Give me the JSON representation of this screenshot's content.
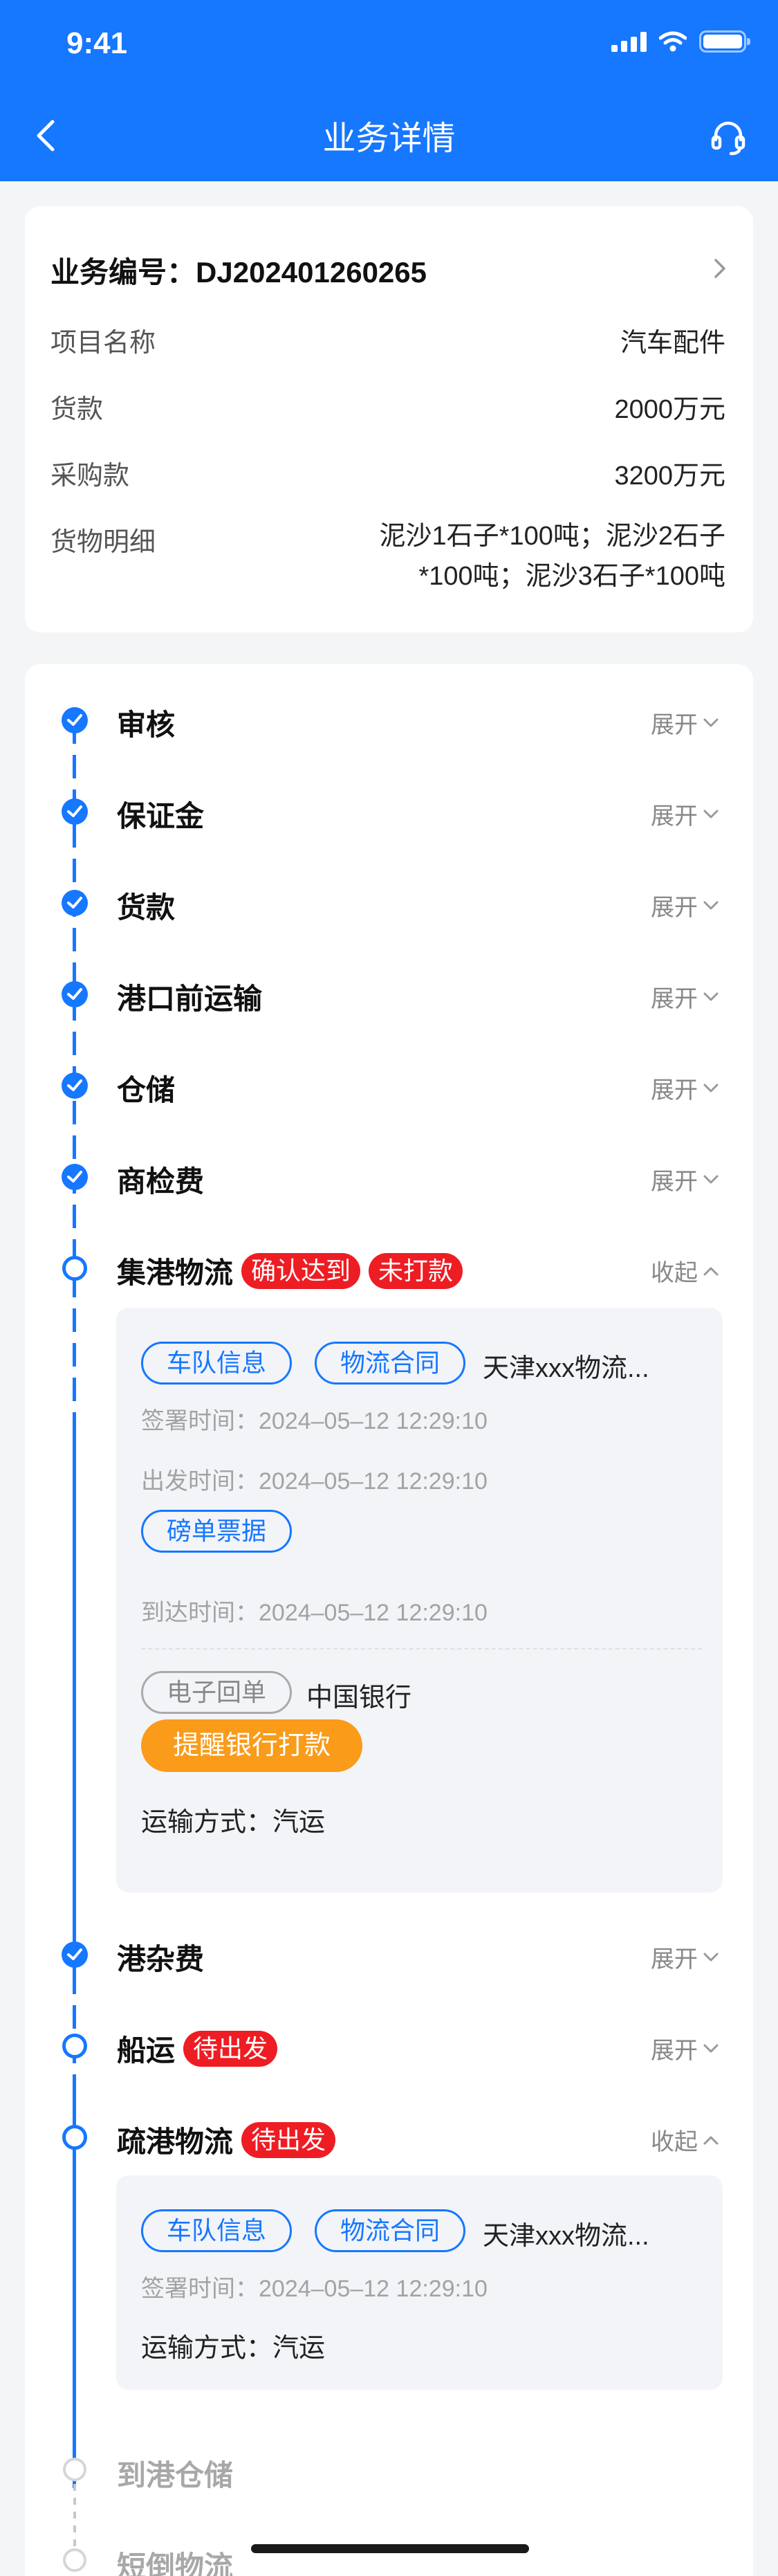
{
  "status_bar": {
    "time": "9:41"
  },
  "header": {
    "title": "业务详情"
  },
  "info": {
    "biz_no_label": "业务编号：",
    "biz_no": "DJ202401260265",
    "rows": [
      {
        "label": "项目名称",
        "value": "汽车配件"
      },
      {
        "label": "货款",
        "value": "2000万元"
      },
      {
        "label": "采购款",
        "value": "3200万元"
      },
      {
        "label": "货物明细",
        "value": "泥沙1石子*100吨；泥沙2石子*100吨；泥沙3石子*100吨"
      }
    ]
  },
  "toggle": {
    "expand": "展开",
    "collapse": "收起"
  },
  "steps": [
    {
      "name": "审核",
      "state": "done"
    },
    {
      "name": "保证金",
      "state": "done"
    },
    {
      "name": "货款",
      "state": "done"
    },
    {
      "name": "港口前运输",
      "state": "done"
    },
    {
      "name": "仓储",
      "state": "done"
    },
    {
      "name": "商检费",
      "state": "done"
    },
    {
      "name": "集港物流",
      "state": "current",
      "tags": [
        "确认达到",
        "未打款"
      ]
    },
    {
      "name": "港杂费",
      "state": "done"
    },
    {
      "name": "船运",
      "state": "current",
      "tags": [
        "待出发"
      ]
    },
    {
      "name": "疏港物流",
      "state": "current",
      "tags": [
        "待出发"
      ]
    },
    {
      "name": "到港仓储",
      "state": "todo"
    },
    {
      "name": "短倒物流",
      "state": "todo"
    }
  ],
  "jigang": {
    "fleet_btn": "车队信息",
    "contract_btn": "物流合同",
    "company": "天津xxx物流...",
    "sign_time": "签署时间：2024–05–12 12:29:10",
    "depart_time": "出发时间：2024–05–12 12:29:10",
    "weigh_btn": "磅单票据",
    "arrive_time": "到达时间：2024–05–12 12:29:10",
    "receipt_btn": "电子回单",
    "bank": "中国银行",
    "remind_btn": "提醒银行打款",
    "transport": "运输方式：汽运"
  },
  "shugang": {
    "fleet_btn": "车队信息",
    "contract_btn": "物流合同",
    "company": "天津xxx物流...",
    "sign_time": "签署时间：2024–05–12 12:29:10",
    "transport": "运输方式：汽运"
  },
  "colors": {
    "primary": "#1677ff",
    "red_tag": "#ee1d23",
    "orange": "#fa9b1a",
    "background": "#f4f5f7"
  }
}
